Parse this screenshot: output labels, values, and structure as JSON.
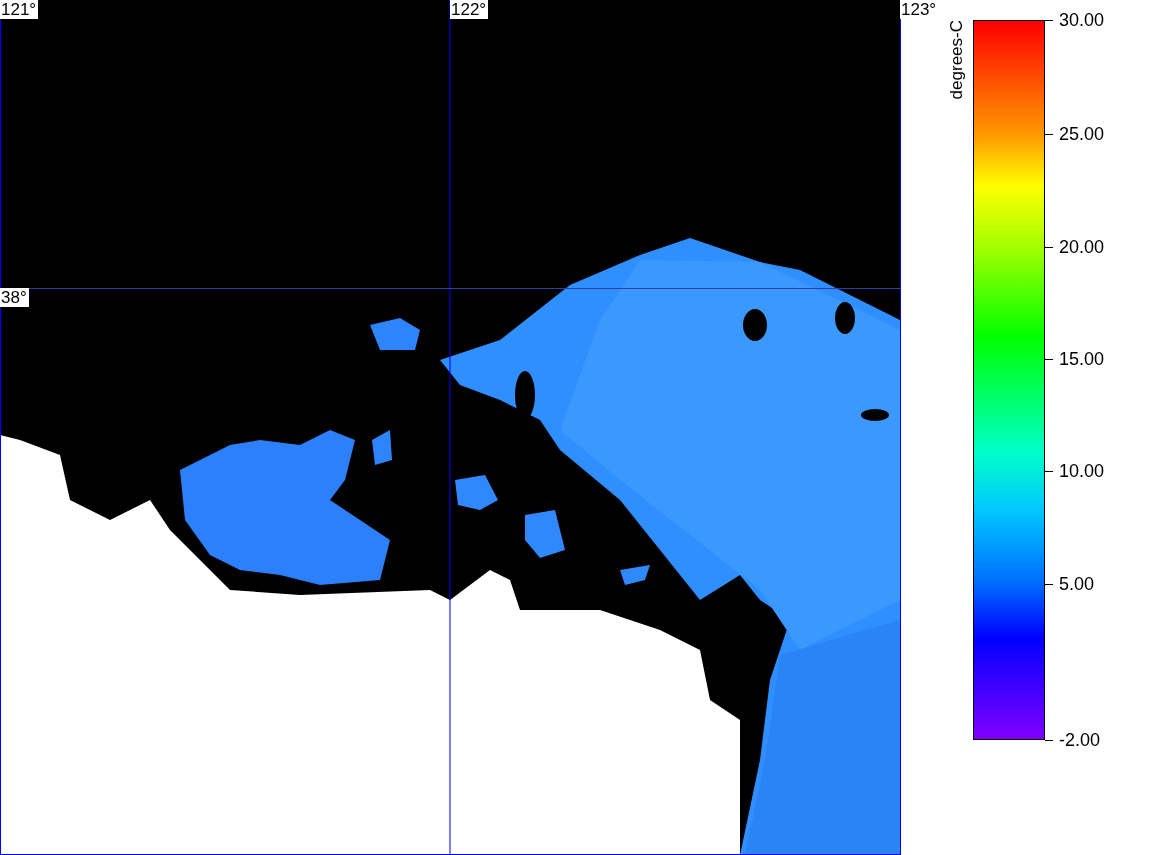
{
  "map": {
    "grid_labels": [
      {
        "text": "121°",
        "kind": "longitude"
      },
      {
        "text": "122°",
        "kind": "longitude"
      },
      {
        "text": "123°",
        "kind": "longitude"
      },
      {
        "text": "38°",
        "kind": "latitude"
      }
    ]
  },
  "legend": {
    "unit": "degrees-C",
    "ticks": [
      "30.00",
      "25.00",
      "20.00",
      "15.00",
      "10.00",
      "5.00",
      "-2.00"
    ]
  }
}
